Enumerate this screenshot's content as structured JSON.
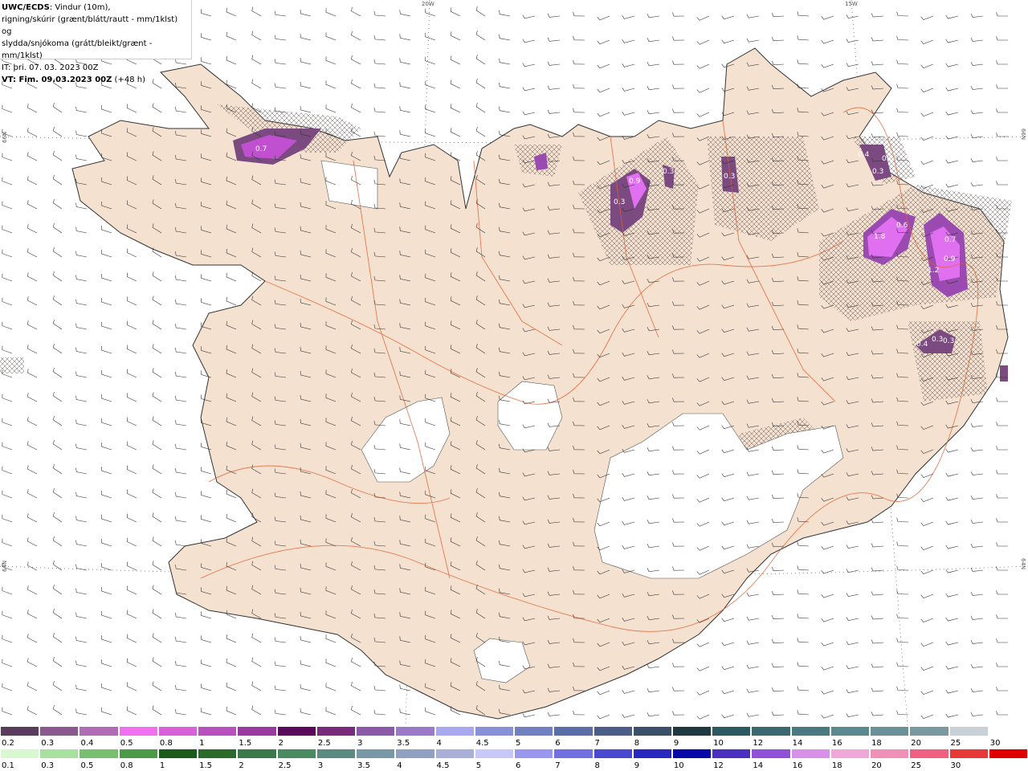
{
  "title": {
    "model": "UWC/ECDS",
    "line1_rest": ": Vindur (10m),",
    "line2": "rigning/skúrir (grænt/blátt/rautt - mm/1klst) og",
    "line3": "slydda/snjókoma (grátt/bleikt/grænt - mm/1klst)",
    "line4": "IT: þri. 07. 03. 2023 00Z",
    "line5_bold": "VT: Fim. 09.03.2023 00Z",
    "line5_rest": " (+48 h)"
  },
  "graticule_labels": {
    "lon_20w": "20W",
    "lon_15w": "15W",
    "lat_66n_left": "66N",
    "lat_66n_right": "66N",
    "lat_64n_left": "64N",
    "lat_64n_right": "64N"
  },
  "precip_labels": [
    "0.7",
    "0.9",
    "0.3",
    "0.3",
    "0.3",
    "0.4",
    "0.3",
    "0.3",
    "1.8",
    "0.6",
    "0.7",
    "1.2",
    "0.9",
    "0.4",
    "0.3",
    "0.3"
  ],
  "snow_scale": {
    "labels": [
      "0.2",
      "0.3",
      "0.4",
      "0.5",
      "0.8",
      "1",
      "1.5",
      "2",
      "2.5",
      "3",
      "3.5",
      "4",
      "4.5",
      "5",
      "6",
      "7",
      "8",
      "9",
      "10",
      "12",
      "14",
      "16",
      "18",
      "20",
      "25",
      "30"
    ],
    "colors": [
      "#5a3d5c",
      "#8a5a8e",
      "#b06cb5",
      "#f070f0",
      "#d860d8",
      "#b850c0",
      "#9a3aa0",
      "#5a0a5a",
      "#7a2a7a",
      "#8a5aa8",
      "#9a7ac8",
      "#a8a8f0",
      "#8890d8",
      "#7080c0",
      "#5a6ea8",
      "#4a5e88",
      "#3a5068",
      "#1e3a40",
      "#2a5a60",
      "#3a6a70",
      "#4a7a80",
      "#5a8a90",
      "#6a9098",
      "#7a98a0",
      "#c8d0d8",
      "#ffffff"
    ]
  },
  "rain_scale": {
    "labels": [
      "0.1",
      "0.3",
      "0.5",
      "0.8",
      "1",
      "1.5",
      "2",
      "2.5",
      "3",
      "3.5",
      "4",
      "4.5",
      "5",
      "6",
      "7",
      "8",
      "9",
      "10",
      "12",
      "14",
      "16",
      "18",
      "20",
      "25",
      "30"
    ],
    "colors": [
      "#d8f8d0",
      "#a8e0a0",
      "#78c070",
      "#4a9a48",
      "#1a5a1a",
      "#2a6a2a",
      "#3a7a4a",
      "#4a8a60",
      "#5a8a80",
      "#7898a8",
      "#90a0c0",
      "#a8b0d8",
      "#c8c8f8",
      "#9898f0",
      "#7070e0",
      "#4848d0",
      "#2828c0",
      "#0808a8",
      "#4a30c0",
      "#9050d8",
      "#d890e8",
      "#f0a8d8",
      "#f090b8",
      "#f06080",
      "#e83838",
      "#e00000"
    ]
  }
}
